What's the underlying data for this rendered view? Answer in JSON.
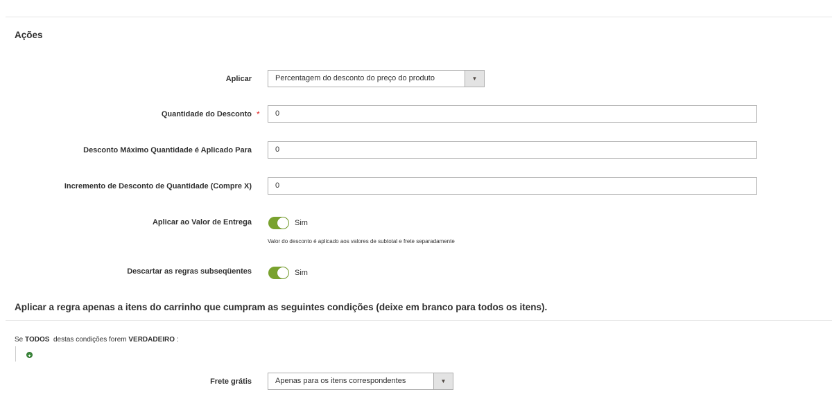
{
  "section": {
    "title": "Ações"
  },
  "fields": {
    "apply": {
      "label": "Aplicar",
      "value": "Percentagem do desconto do preço do produto"
    },
    "discount_amount": {
      "label": "Quantidade do Desconto",
      "required_mark": "*",
      "value": "0"
    },
    "max_qty": {
      "label": "Desconto Máximo Quantidade é Aplicado Para",
      "value": "0"
    },
    "qty_step": {
      "label": "Incremento de Desconto de Quantidade (Compre X)",
      "value": "0"
    },
    "apply_shipping": {
      "label": "Aplicar ao Valor de Entrega",
      "state": "Sim",
      "note": "Valor do desconto é aplicado aos valores de subtotal e frete separadamente"
    },
    "discard_rules": {
      "label": "Descartar as regras subseqüentes",
      "state": "Sim"
    }
  },
  "conditions": {
    "title": "Aplicar a regra apenas a itens do carrinho que cumpram as seguintes condições (deixe em branco para todos os itens).",
    "prefix": "Se",
    "aggregator": "TODOS",
    "middle": "destas condições forem",
    "value": "VERDADEIRO",
    "suffix": ":"
  },
  "free_shipping": {
    "label": "Frete grátis",
    "value": "Apenas para os itens correspondentes"
  },
  "colors": {
    "toggle_on": "#79a22e",
    "required": "#e22626",
    "add_icon": "#3d8c3d"
  }
}
